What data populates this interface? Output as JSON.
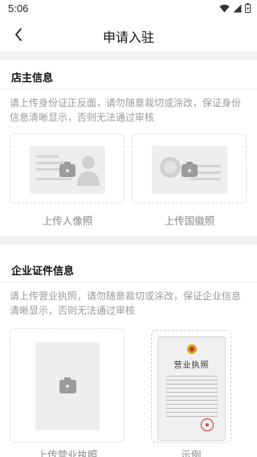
{
  "status_bar": {
    "time": "5:06"
  },
  "nav": {
    "title": "申请入驻"
  },
  "owner_section": {
    "title": "店主信息",
    "description": "请上传身份证正反面，请勿随意裁切或涂改，保证身份信息清晰显示，否则无法通过审核",
    "portrait_label": "上传人像照",
    "emblem_label": "上传国徽照"
  },
  "license_section": {
    "title": "企业证件信息",
    "description": "请上传营业执照，请勿随意裁切或涂改，保证企业信息清晰显示，否则无法通过审核",
    "upload_label": "上传营业执照",
    "sample_label": "示例",
    "sample_heading": "营业执照"
  }
}
